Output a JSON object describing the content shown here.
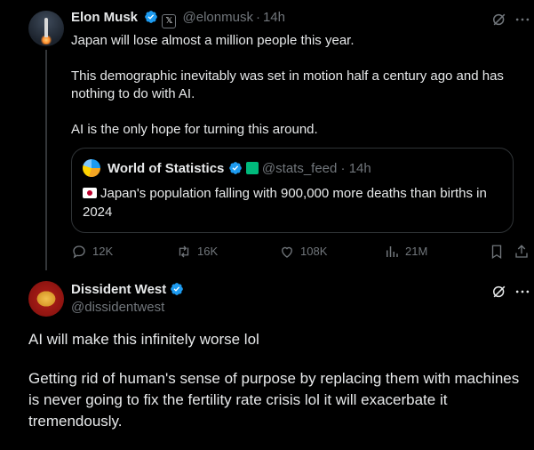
{
  "tweet1": {
    "author_name": "Elon Musk",
    "handle": "@elonmusk",
    "separator": "·",
    "time": "14h",
    "body_lines": [
      "Japan will lose almost a million people this year.",
      "This demographic inevitably was set in motion half a century ago and has nothing to do with AI.",
      "AI is the only hope for turning this around."
    ],
    "quote": {
      "author_name": "World of Statistics",
      "handle": "@stats_feed",
      "separator": "·",
      "time": "14h",
      "text": "Japan's population falling with 900,000 more deaths than births in 2024",
      "flag_icon": "japan-flag-icon"
    },
    "actions": {
      "replies": "12K",
      "reposts": "16K",
      "likes": "108K",
      "views": "21M"
    },
    "badges": {
      "verified": "verified-icon",
      "affiliate": "x-affiliate-icon"
    }
  },
  "tweet2": {
    "author_name": "Dissident West",
    "handle": "@dissidentwest",
    "body_lines": [
      "AI will make this infinitely worse lol",
      "Getting rid of human's sense of purpose by replacing them with machines is never going to fix the fertility rate crisis lol it will exacerbate it tremendously."
    ]
  },
  "colors": {
    "background": "#000000",
    "text": "#e7e9ea",
    "muted": "#71767b",
    "verified_blue": "#1d9bf0",
    "border": "#2f3336"
  }
}
